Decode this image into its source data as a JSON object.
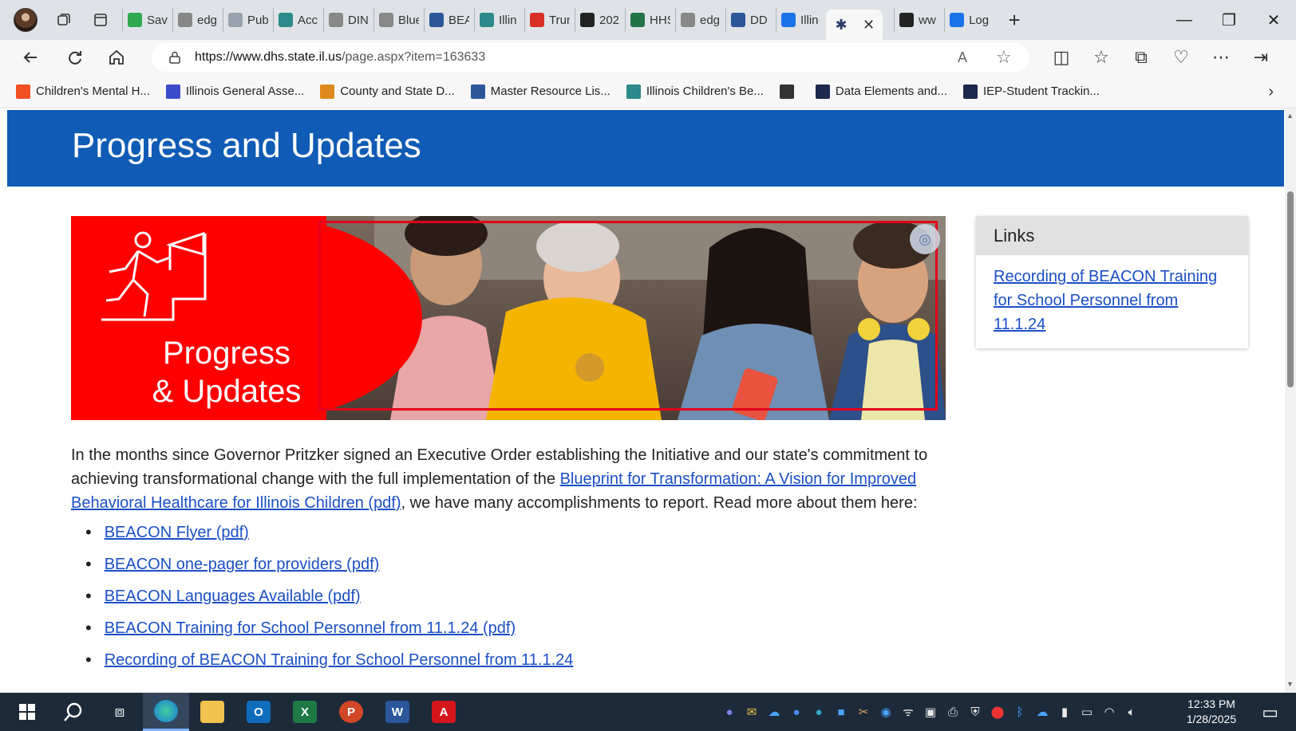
{
  "browser": {
    "tabs": [
      {
        "label": "Sav",
        "icon": "spreadsheet-icon",
        "color": "#2fa84f"
      },
      {
        "label": "edg",
        "icon": "page-icon",
        "color": "#888888"
      },
      {
        "label": "Pub",
        "icon": "pub-icon",
        "color": "#9aa3ad"
      },
      {
        "label": "Acc",
        "icon": "globe-icon",
        "color": "#2c8a8a"
      },
      {
        "label": "DIN",
        "icon": "page-icon",
        "color": "#888888"
      },
      {
        "label": "Blue",
        "icon": "page-icon",
        "color": "#888888"
      },
      {
        "label": "BEA",
        "icon": "word-icon",
        "color": "#2b579a"
      },
      {
        "label": "Illin",
        "icon": "globe-icon",
        "color": "#2c8a8a"
      },
      {
        "label": "Trun",
        "icon": "gmail-icon",
        "color": "#d93025"
      },
      {
        "label": "202",
        "icon": "nyt-icon",
        "color": "#222222"
      },
      {
        "label": "HHS",
        "icon": "excel-icon",
        "color": "#217346"
      },
      {
        "label": "edg",
        "icon": "page-icon",
        "color": "#888888"
      },
      {
        "label": "DD",
        "icon": "word-icon",
        "color": "#2b579a"
      },
      {
        "label": "Illin",
        "icon": "search-icon",
        "color": "#1a73e8"
      }
    ],
    "active_tab_icon": "puzzle-icon",
    "after_tabs": [
      {
        "label": "ww",
        "icon": "document-icon",
        "color": "#222222"
      },
      {
        "label": "Log",
        "icon": "link-icon",
        "color": "#1a73e8"
      }
    ],
    "url_domain": "https://www.dhs.state.il.us",
    "url_path": "/page.aspx?item=163633",
    "favorites": [
      {
        "label": "Children's Mental H...",
        "color": "#f25022"
      },
      {
        "label": "Illinois General Asse...",
        "color": "#3b4cca"
      },
      {
        "label": "County and State D...",
        "color": "#e08a1e"
      },
      {
        "label": "Master Resource Lis...",
        "color": "#2b579a"
      },
      {
        "label": "Illinois Children's Be...",
        "color": "#2c8a8a"
      },
      {
        "label": "",
        "color": "#333333"
      },
      {
        "label": "Data Elements and...",
        "color": "#1d2a4d"
      },
      {
        "label": "IEP-Student Trackin...",
        "color": "#1d2a4d"
      }
    ]
  },
  "page": {
    "banner_title": "Progress and Updates",
    "hero": {
      "line1": "Progress",
      "line2": "& Updates",
      "red": "#ff0000"
    },
    "links_box": {
      "heading": "Links",
      "link": "Recording of BEACON Training for School Personnel from 11.1.24"
    },
    "intro_before": "In the months since Governor Pritzker signed an Executive Order establishing the Initiative and our state's commitment to achieving transformational change with the full implementation of the ",
    "intro_link": "Blueprint for Transformation: A Vision for Improved Behavioral Healthcare for Illinois Children (pdf)",
    "intro_after": ", we have many accomplishments to report. Read more about them here:",
    "resources": [
      "BEACON Flyer (pdf)",
      "BEACON one-pager for providers (pdf)",
      "BEACON Languages Available (pdf)",
      "BEACON Training for School Personnel from 11.1.24 (pdf)",
      "Recording of BEACON Training for School Personnel from 11.1.24"
    ]
  },
  "taskbar": {
    "time": "12:33 PM",
    "date": "1/28/2025"
  },
  "colors": {
    "banner": "#0f5bb5",
    "link": "#1a4fc4"
  }
}
